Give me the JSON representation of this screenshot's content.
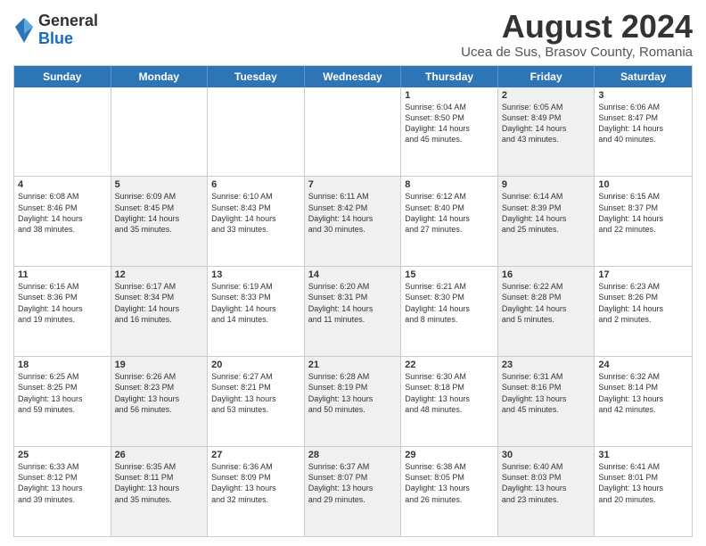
{
  "logo": {
    "general": "General",
    "blue": "Blue"
  },
  "header": {
    "title": "August 2024",
    "subtitle": "Ucea de Sus, Brasov County, Romania"
  },
  "days": [
    "Sunday",
    "Monday",
    "Tuesday",
    "Wednesday",
    "Thursday",
    "Friday",
    "Saturday"
  ],
  "rows": [
    [
      {
        "num": "",
        "detail": "",
        "shaded": false
      },
      {
        "num": "",
        "detail": "",
        "shaded": false
      },
      {
        "num": "",
        "detail": "",
        "shaded": false
      },
      {
        "num": "",
        "detail": "",
        "shaded": false
      },
      {
        "num": "1",
        "detail": "Sunrise: 6:04 AM\nSunset: 8:50 PM\nDaylight: 14 hours\nand 45 minutes.",
        "shaded": false
      },
      {
        "num": "2",
        "detail": "Sunrise: 6:05 AM\nSunset: 8:49 PM\nDaylight: 14 hours\nand 43 minutes.",
        "shaded": true
      },
      {
        "num": "3",
        "detail": "Sunrise: 6:06 AM\nSunset: 8:47 PM\nDaylight: 14 hours\nand 40 minutes.",
        "shaded": false
      }
    ],
    [
      {
        "num": "4",
        "detail": "Sunrise: 6:08 AM\nSunset: 8:46 PM\nDaylight: 14 hours\nand 38 minutes.",
        "shaded": false
      },
      {
        "num": "5",
        "detail": "Sunrise: 6:09 AM\nSunset: 8:45 PM\nDaylight: 14 hours\nand 35 minutes.",
        "shaded": true
      },
      {
        "num": "6",
        "detail": "Sunrise: 6:10 AM\nSunset: 8:43 PM\nDaylight: 14 hours\nand 33 minutes.",
        "shaded": false
      },
      {
        "num": "7",
        "detail": "Sunrise: 6:11 AM\nSunset: 8:42 PM\nDaylight: 14 hours\nand 30 minutes.",
        "shaded": true
      },
      {
        "num": "8",
        "detail": "Sunrise: 6:12 AM\nSunset: 8:40 PM\nDaylight: 14 hours\nand 27 minutes.",
        "shaded": false
      },
      {
        "num": "9",
        "detail": "Sunrise: 6:14 AM\nSunset: 8:39 PM\nDaylight: 14 hours\nand 25 minutes.",
        "shaded": true
      },
      {
        "num": "10",
        "detail": "Sunrise: 6:15 AM\nSunset: 8:37 PM\nDaylight: 14 hours\nand 22 minutes.",
        "shaded": false
      }
    ],
    [
      {
        "num": "11",
        "detail": "Sunrise: 6:16 AM\nSunset: 8:36 PM\nDaylight: 14 hours\nand 19 minutes.",
        "shaded": false
      },
      {
        "num": "12",
        "detail": "Sunrise: 6:17 AM\nSunset: 8:34 PM\nDaylight: 14 hours\nand 16 minutes.",
        "shaded": true
      },
      {
        "num": "13",
        "detail": "Sunrise: 6:19 AM\nSunset: 8:33 PM\nDaylight: 14 hours\nand 14 minutes.",
        "shaded": false
      },
      {
        "num": "14",
        "detail": "Sunrise: 6:20 AM\nSunset: 8:31 PM\nDaylight: 14 hours\nand 11 minutes.",
        "shaded": true
      },
      {
        "num": "15",
        "detail": "Sunrise: 6:21 AM\nSunset: 8:30 PM\nDaylight: 14 hours\nand 8 minutes.",
        "shaded": false
      },
      {
        "num": "16",
        "detail": "Sunrise: 6:22 AM\nSunset: 8:28 PM\nDaylight: 14 hours\nand 5 minutes.",
        "shaded": true
      },
      {
        "num": "17",
        "detail": "Sunrise: 6:23 AM\nSunset: 8:26 PM\nDaylight: 14 hours\nand 2 minutes.",
        "shaded": false
      }
    ],
    [
      {
        "num": "18",
        "detail": "Sunrise: 6:25 AM\nSunset: 8:25 PM\nDaylight: 13 hours\nand 59 minutes.",
        "shaded": false
      },
      {
        "num": "19",
        "detail": "Sunrise: 6:26 AM\nSunset: 8:23 PM\nDaylight: 13 hours\nand 56 minutes.",
        "shaded": true
      },
      {
        "num": "20",
        "detail": "Sunrise: 6:27 AM\nSunset: 8:21 PM\nDaylight: 13 hours\nand 53 minutes.",
        "shaded": false
      },
      {
        "num": "21",
        "detail": "Sunrise: 6:28 AM\nSunset: 8:19 PM\nDaylight: 13 hours\nand 50 minutes.",
        "shaded": true
      },
      {
        "num": "22",
        "detail": "Sunrise: 6:30 AM\nSunset: 8:18 PM\nDaylight: 13 hours\nand 48 minutes.",
        "shaded": false
      },
      {
        "num": "23",
        "detail": "Sunrise: 6:31 AM\nSunset: 8:16 PM\nDaylight: 13 hours\nand 45 minutes.",
        "shaded": true
      },
      {
        "num": "24",
        "detail": "Sunrise: 6:32 AM\nSunset: 8:14 PM\nDaylight: 13 hours\nand 42 minutes.",
        "shaded": false
      }
    ],
    [
      {
        "num": "25",
        "detail": "Sunrise: 6:33 AM\nSunset: 8:12 PM\nDaylight: 13 hours\nand 39 minutes.",
        "shaded": false
      },
      {
        "num": "26",
        "detail": "Sunrise: 6:35 AM\nSunset: 8:11 PM\nDaylight: 13 hours\nand 35 minutes.",
        "shaded": true
      },
      {
        "num": "27",
        "detail": "Sunrise: 6:36 AM\nSunset: 8:09 PM\nDaylight: 13 hours\nand 32 minutes.",
        "shaded": false
      },
      {
        "num": "28",
        "detail": "Sunrise: 6:37 AM\nSunset: 8:07 PM\nDaylight: 13 hours\nand 29 minutes.",
        "shaded": true
      },
      {
        "num": "29",
        "detail": "Sunrise: 6:38 AM\nSunset: 8:05 PM\nDaylight: 13 hours\nand 26 minutes.",
        "shaded": false
      },
      {
        "num": "30",
        "detail": "Sunrise: 6:40 AM\nSunset: 8:03 PM\nDaylight: 13 hours\nand 23 minutes.",
        "shaded": true
      },
      {
        "num": "31",
        "detail": "Sunrise: 6:41 AM\nSunset: 8:01 PM\nDaylight: 13 hours\nand 20 minutes.",
        "shaded": false
      }
    ]
  ]
}
